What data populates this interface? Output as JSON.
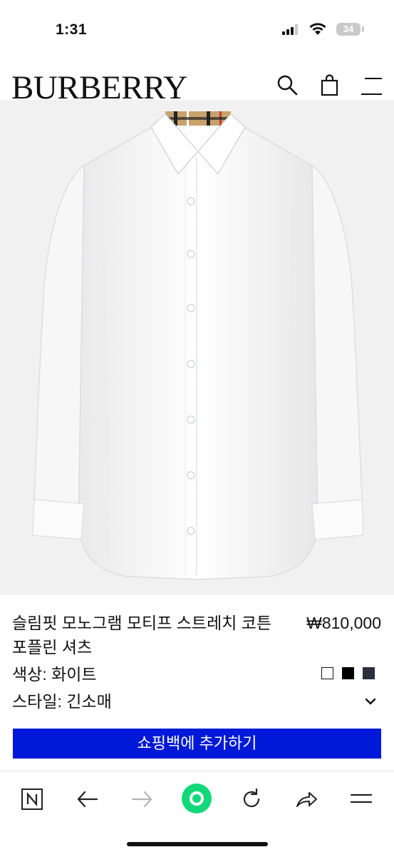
{
  "status_bar": {
    "time": "1:31",
    "battery": "34"
  },
  "header": {
    "brand": "BURBERRY",
    "search_icon": "search-icon",
    "bag_icon": "shopping-bag-icon",
    "menu_icon": "menu-icon"
  },
  "product": {
    "title": "슬림핏 모노그램 모티프 스트레치 코튼 포플린 셔츠",
    "price": "₩810,000",
    "color_label": "색상: 화이트",
    "swatch_colors": [
      "#ffffff",
      "#000000",
      "#2b2f3c"
    ],
    "style_label": "스타일: 긴소매",
    "add_to_bag": "쇼핑백에 추가하기",
    "accent": "#0019d8"
  },
  "browser_bar": {
    "icons": [
      "naver-n-icon",
      "back-arrow-icon",
      "forward-arrow-icon",
      "green-home-icon",
      "reload-icon",
      "share-icon",
      "menu-icon"
    ],
    "green": "#12d879"
  }
}
